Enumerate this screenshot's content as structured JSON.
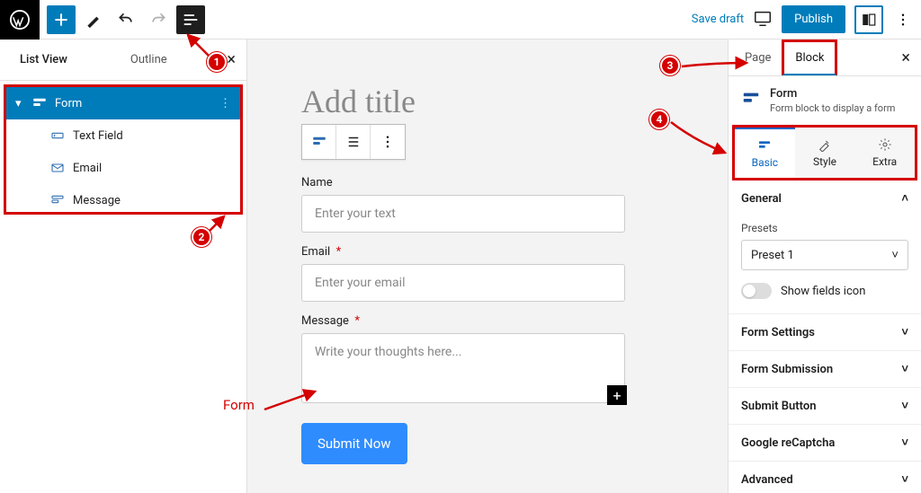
{
  "topbar": {
    "save_draft": "Save draft",
    "publish": "Publish"
  },
  "leftpanel": {
    "tabs": {
      "list_view": "List View",
      "outline": "Outline"
    },
    "form": "Form",
    "children": [
      "Text Field",
      "Email",
      "Message"
    ]
  },
  "canvas": {
    "title_placeholder": "Add title",
    "name_label": "Name",
    "name_ph": "Enter your text",
    "email_label": "Email",
    "email_ph": "Enter your email",
    "message_label": "Message",
    "message_ph": "Write your thoughts here...",
    "submit": "Submit Now",
    "form_caption": "Form"
  },
  "sidebar": {
    "tabs": {
      "page": "Page",
      "block": "Block"
    },
    "block_name": "Form",
    "block_desc": "Form block to display a form",
    "subtabs": {
      "basic": "Basic",
      "style": "Style",
      "extra": "Extra"
    },
    "sections": {
      "general": "General",
      "presets_label": "Presets",
      "preset_value": "Preset 1",
      "show_fields_icon": "Show fields icon",
      "form_settings": "Form Settings",
      "form_submission": "Form Submission",
      "submit_button": "Submit Button",
      "recaptcha": "Google reCaptcha",
      "advanced": "Advanced"
    }
  },
  "markers": {
    "m1": "1",
    "m2": "2",
    "m3": "3",
    "m4": "4"
  }
}
